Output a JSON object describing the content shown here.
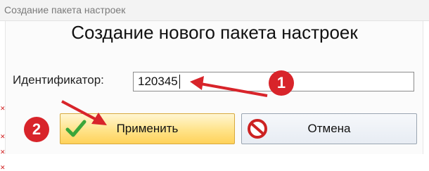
{
  "window": {
    "title": "Создание пакета настроек"
  },
  "dialog": {
    "heading": "Создание нового пакета настроек",
    "identifier_label": "Идентификатор:",
    "identifier_value": "120345"
  },
  "buttons": {
    "apply_label": "Применить",
    "cancel_label": "Отмена"
  },
  "annotations": {
    "step1": "1",
    "step2": "2"
  },
  "icons": {
    "apply": "checkmark-icon",
    "cancel": "prohibited-icon"
  },
  "colors": {
    "annotation_red": "#d8242a",
    "apply_yellow": "#ffe389",
    "check_green": "#3aa63a"
  }
}
